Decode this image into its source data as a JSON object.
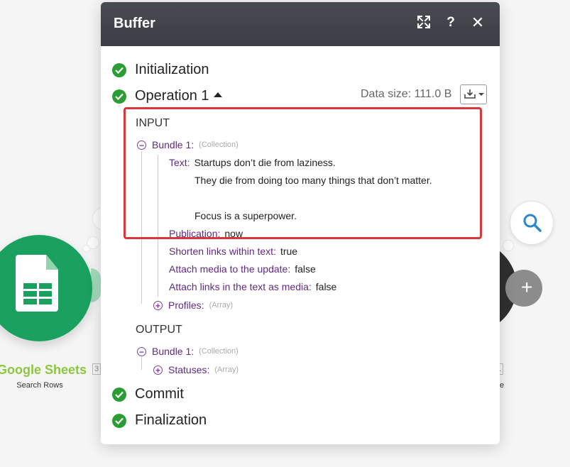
{
  "colors": {
    "header_bg": "#3f4248",
    "check_green": "#2a9d35",
    "key_purple": "#5f2a82",
    "highlight_red": "#d7383d",
    "sheets_green": "#1aa15f",
    "sheets_label_green": "#8dc63f"
  },
  "background": {
    "left_module": {
      "name": "Google Sheets",
      "count": "3",
      "sublabel": "Search Rows",
      "icon": "google-sheets-icon"
    },
    "right_module": {
      "count": "1",
      "sublabel": "e",
      "icon": "magnifier-icon",
      "add_icon": "plus-icon"
    }
  },
  "modal": {
    "title": "Buffer",
    "header_icons": {
      "expand": "expand-arrows-icon",
      "help": "?",
      "close": "✕"
    },
    "stages": {
      "initialization": "Initialization",
      "operation": "Operation 1",
      "commit": "Commit",
      "finalization": "Finalization"
    },
    "data_size": "Data size: 111.0 B",
    "download_icon": "download-icon",
    "input": {
      "label": "INPUT",
      "bundle": {
        "key": "Bundle 1:",
        "type": "(Collection)",
        "toggle": "−"
      },
      "text": {
        "key": "Text:",
        "lines": [
          "Startups don’t die from laziness.",
          "They die from doing too many things that don’t matter.",
          "",
          "Focus is a superpower."
        ]
      },
      "publication": {
        "key": "Publication:",
        "value": "now"
      },
      "shorten_links": {
        "key": "Shorten links within text:",
        "value": "true"
      },
      "attach_media": {
        "key": "Attach media to the update:",
        "value": "false"
      },
      "attach_links": {
        "key": "Attach links in the text as media:",
        "value": "false"
      },
      "profiles": {
        "key": "Profiles:",
        "type": "(Array)",
        "toggle": "+"
      }
    },
    "output": {
      "label": "OUTPUT",
      "bundle": {
        "key": "Bundle 1:",
        "type": "(Collection)",
        "toggle": "−"
      },
      "statuses": {
        "key": "Statuses:",
        "type": "(Array)",
        "toggle": "+"
      }
    }
  }
}
